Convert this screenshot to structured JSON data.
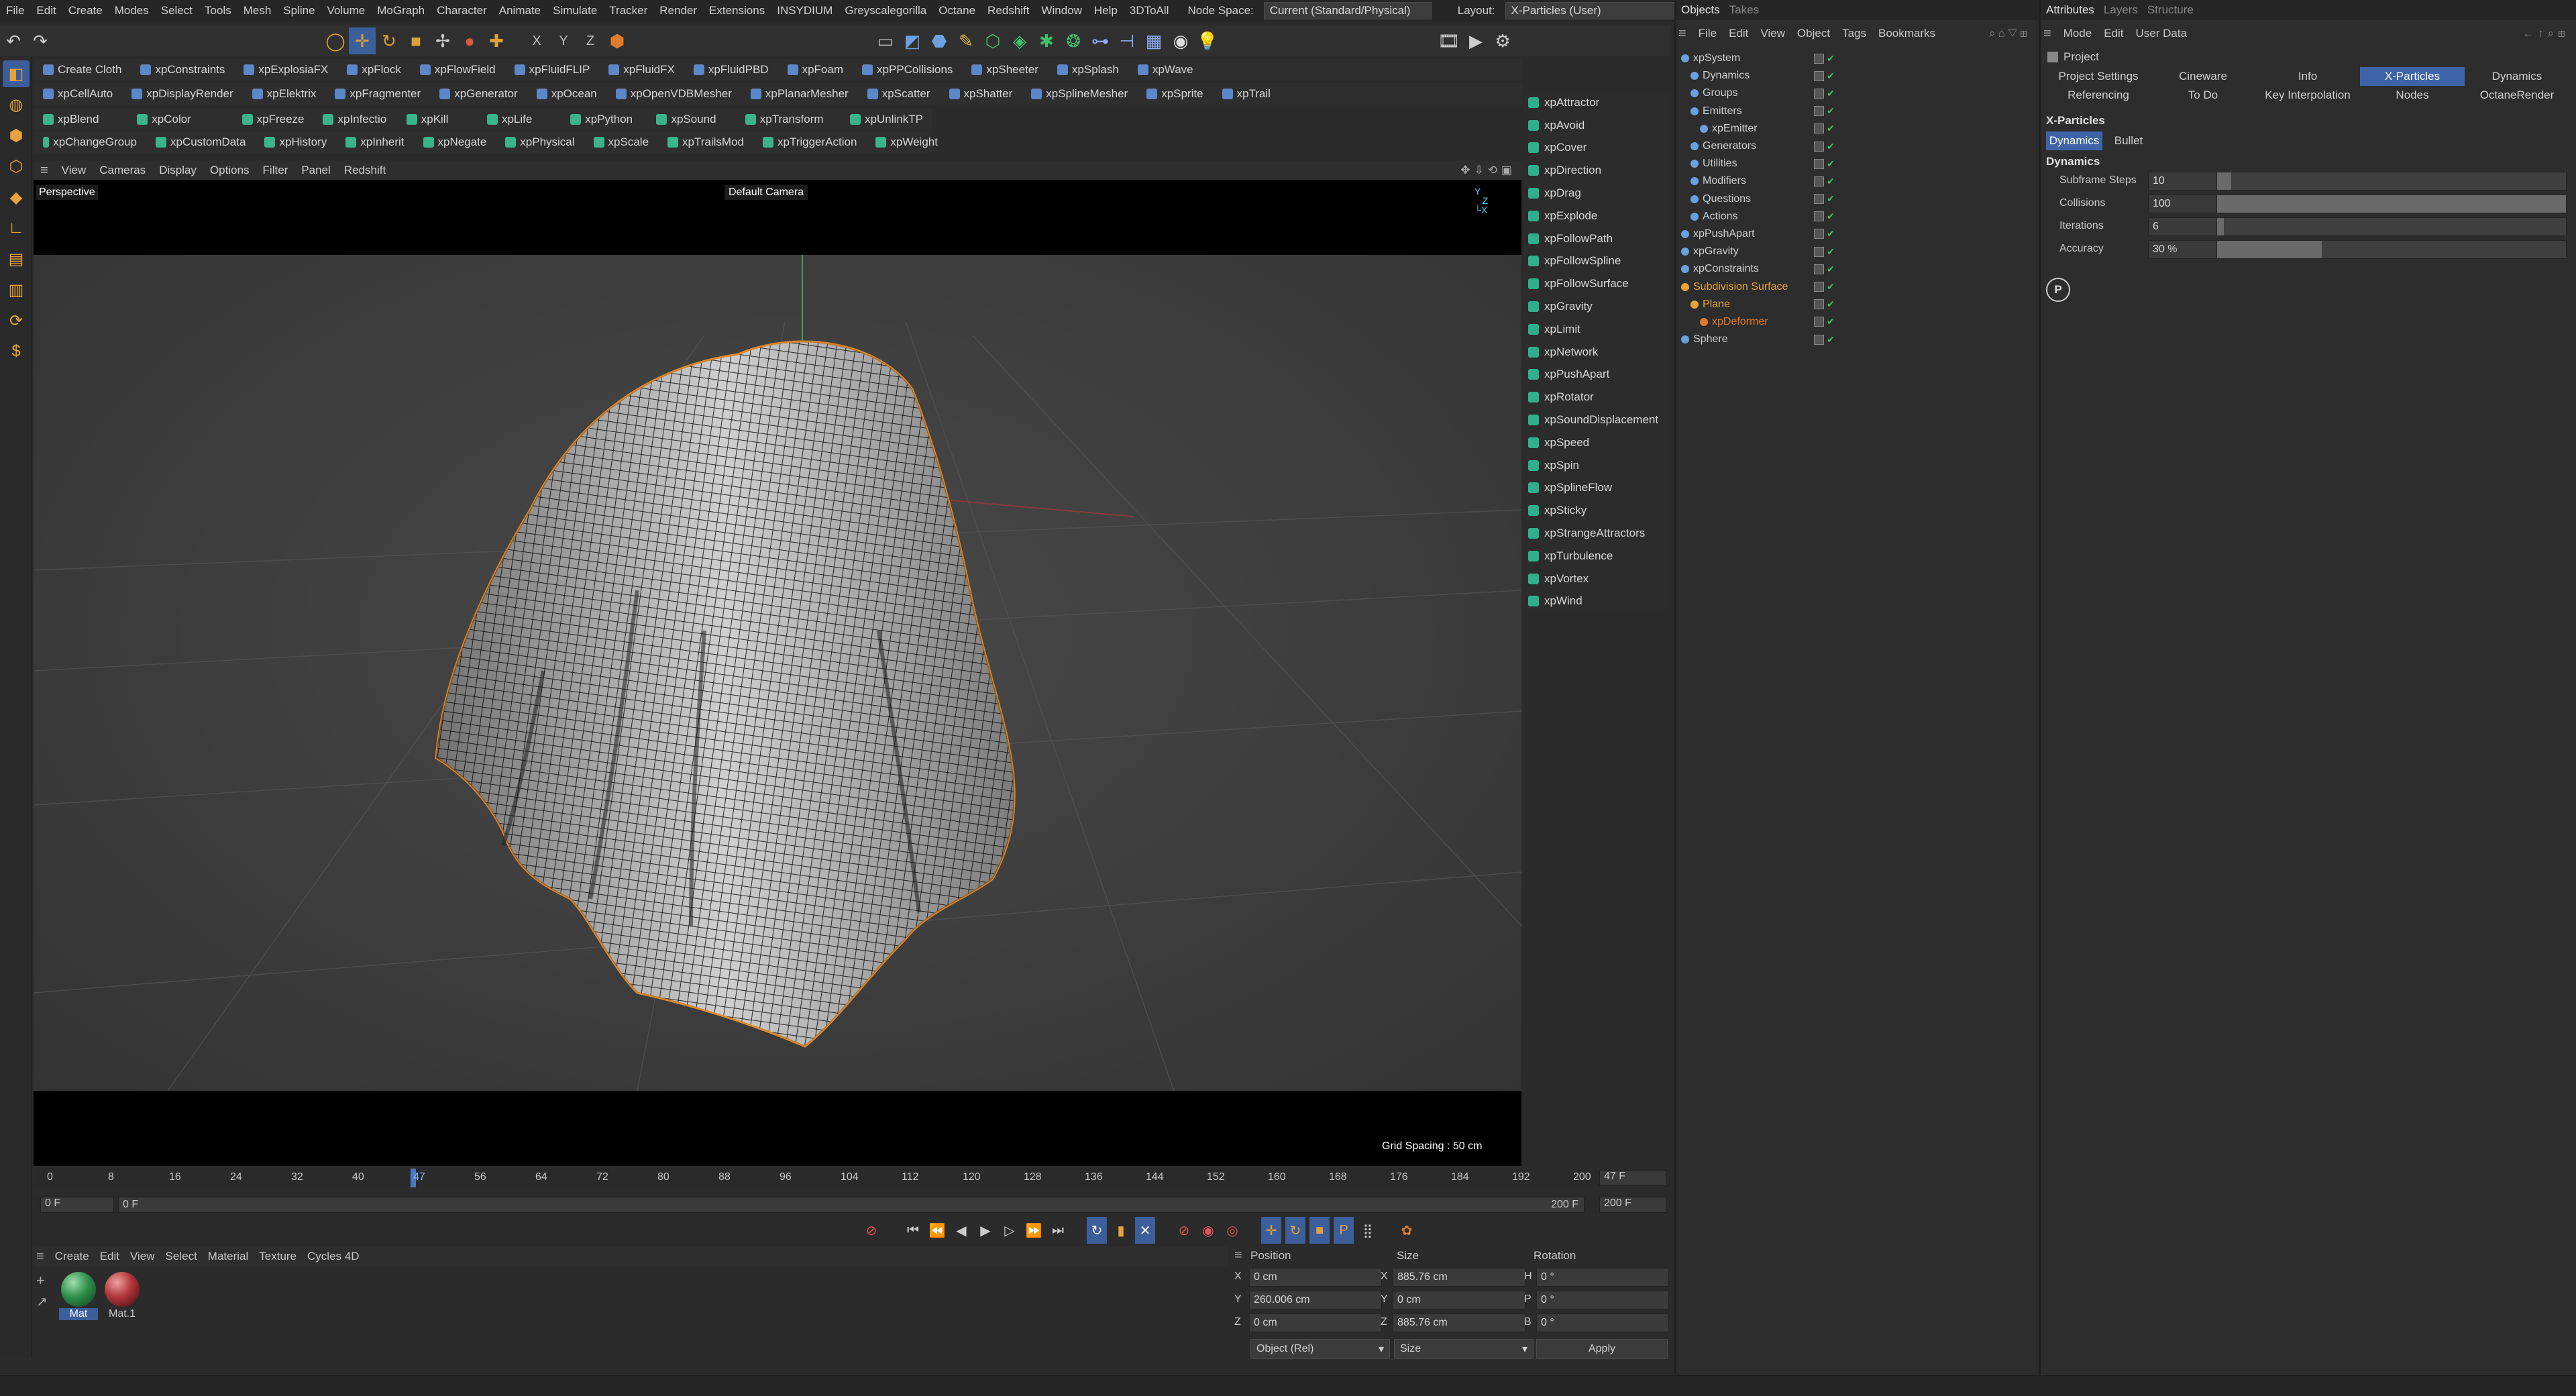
{
  "menubar": {
    "items": [
      "File",
      "Edit",
      "Create",
      "Modes",
      "Select",
      "Tools",
      "Mesh",
      "Spline",
      "Volume",
      "MoGraph",
      "Character",
      "Animate",
      "Simulate",
      "Tracker",
      "Render",
      "Extensions",
      "INSYDIUM",
      "Greyscalegorilla",
      "Octane",
      "Redshift",
      "Window",
      "Help",
      "3DToAll"
    ],
    "node_space_label": "Node Space:",
    "node_space_value": "Current (Standard/Physical)",
    "layout_label": "Layout:",
    "layout_value": "X-Particles (User)"
  },
  "toolbar": {
    "axis_labels": [
      "X",
      "Y",
      "Z"
    ]
  },
  "plugin_rows": {
    "row1": [
      "Create Cloth",
      "xpConstraints",
      "xpExplosiaFX",
      "xpFlock",
      "xpFlowField",
      "xpFluidFLIP",
      "xpFluidFX",
      "xpFluidPBD",
      "xpFoam",
      "xpPPCollisions",
      "xpSheeter",
      "xpSplash",
      "xpWave"
    ],
    "row2": [
      "xpCellAuto",
      "xpDisplayRender",
      "xpElektrix",
      "xpFragmenter",
      "xpGenerator",
      "xpOcean",
      "xpOpenVDBMesher",
      "xpPlanarMesher",
      "xpScatter",
      "xpShatter",
      "xpSplineMesher",
      "xpSprite",
      "xpTrail"
    ],
    "row3": [
      "xpBlend",
      "xpColor",
      "xpFreeze",
      "xpInfectio",
      "xpKill",
      "xpLife",
      "xpPython",
      "xpSound",
      "xpTransform",
      "xpUnlinkTP"
    ],
    "row4": [
      "xpChangeGroup",
      "xpCustomData",
      "xpHistory",
      "xpInherit",
      "xpNegate",
      "xpPhysical",
      "xpScale",
      "xpTrailsMod",
      "xpTriggerAction",
      "xpWeight"
    ]
  },
  "viewport": {
    "menu": [
      "View",
      "Cameras",
      "Display",
      "Options",
      "Filter",
      "Panel",
      "Redshift"
    ],
    "label": "Perspective",
    "camera": "Default Camera",
    "grid_spacing": "Grid Spacing : 50 cm"
  },
  "generators": [
    "xpAttractor",
    "xpAvoid",
    "xpCover",
    "xpDirection",
    "xpDrag",
    "xpExplode",
    "xpFollowPath",
    "xpFollowSpline",
    "xpFollowSurface",
    "xpGravity",
    "xpLimit",
    "xpNetwork",
    "xpPushApart",
    "xpRotator",
    "xpSoundDisplacement",
    "xpSpeed",
    "xpSpin",
    "xpSplineFlow",
    "xpSticky",
    "xpStrangeAttractors",
    "xpTurbulence",
    "xpVortex",
    "xpWind"
  ],
  "objects": {
    "tabs": [
      "Objects",
      "Takes"
    ],
    "menu": [
      "File",
      "Edit",
      "View",
      "Object",
      "Tags",
      "Bookmarks"
    ],
    "tree": [
      {
        "name": "xpSystem",
        "level": 0,
        "color": "#cfcfcf"
      },
      {
        "name": "Dynamics",
        "level": 1,
        "color": "#cfcfcf"
      },
      {
        "name": "Groups",
        "level": 1,
        "color": "#cfcfcf"
      },
      {
        "name": "Emitters",
        "level": 1,
        "color": "#cfcfcf"
      },
      {
        "name": "xpEmitter",
        "level": 2,
        "color": "#cfcfcf"
      },
      {
        "name": "Generators",
        "level": 1,
        "color": "#cfcfcf"
      },
      {
        "name": "Utilities",
        "level": 1,
        "color": "#cfcfcf"
      },
      {
        "name": "Modifiers",
        "level": 1,
        "color": "#cfcfcf"
      },
      {
        "name": "Questions",
        "level": 1,
        "color": "#cfcfcf"
      },
      {
        "name": "Actions",
        "level": 1,
        "color": "#cfcfcf"
      },
      {
        "name": "xpPushApart",
        "level": 0,
        "color": "#cfcfcf"
      },
      {
        "name": "xpGravity",
        "level": 0,
        "color": "#cfcfcf"
      },
      {
        "name": "xpConstraints",
        "level": 0,
        "color": "#cfcfcf"
      },
      {
        "name": "Subdivision Surface",
        "level": 0,
        "color": "#e8a23a"
      },
      {
        "name": "Plane",
        "level": 1,
        "color": "#e8a23a"
      },
      {
        "name": "xpDeformer",
        "level": 2,
        "color": "#e07b2a"
      },
      {
        "name": "Sphere",
        "level": 0,
        "color": "#cfcfcf"
      }
    ]
  },
  "attributes": {
    "tabs": [
      "Attributes",
      "Layers",
      "Structure"
    ],
    "menu": [
      "Mode",
      "Edit",
      "User Data"
    ],
    "object_title": "Project",
    "tab_row1": [
      "Project Settings",
      "Cineware",
      "Info",
      "X-Particles",
      "Dynamics"
    ],
    "tab_row2": [
      "Referencing",
      "To Do",
      "Key Interpolation",
      "Nodes",
      "OctaneRender"
    ],
    "active_tab": "X-Particles",
    "section_title": "X-Particles",
    "subtabs": [
      "Dynamics",
      "Bullet"
    ],
    "group_title": "Dynamics",
    "params": [
      {
        "label": "Subframe Steps",
        "value": "10",
        "fill": 0.04
      },
      {
        "label": "Collisions",
        "value": "100",
        "fill": 1.0
      },
      {
        "label": "Iterations",
        "value": "6",
        "fill": 0.02
      },
      {
        "label": "Accuracy",
        "value": "30 %",
        "fill": 0.3
      }
    ]
  },
  "timeline": {
    "ticks": [
      "0",
      "8",
      "16",
      "24",
      "32",
      "40",
      "47",
      "56",
      "64",
      "72",
      "80",
      "88",
      "96",
      "104",
      "112",
      "120",
      "128",
      "136",
      "144",
      "152",
      "160",
      "168",
      "176",
      "184",
      "192",
      "200"
    ],
    "current_frame": "47 F",
    "start_frame": "0 F",
    "range_start": "0 F",
    "range_end": "200 F",
    "end_frame": "200 F"
  },
  "materials": {
    "menu": [
      "Create",
      "Edit",
      "View",
      "Select",
      "Material",
      "Texture",
      "Cycles 4D"
    ],
    "items": [
      {
        "name": "Mat",
        "color": "#2f8f4a"
      },
      {
        "name": "Mat.1",
        "color": "#b0353a"
      }
    ]
  },
  "coordinates": {
    "headers": [
      "Position",
      "Size",
      "Rotation"
    ],
    "rows": [
      {
        "axis": "X",
        "pos": "0 cm",
        "size_axis": "X",
        "size": "885.76 cm",
        "rot_axis": "H",
        "rot": "0 °"
      },
      {
        "axis": "Y",
        "pos": "260.006 cm",
        "size_axis": "Y",
        "size": "0 cm",
        "rot_axis": "P",
        "rot": "0 °"
      },
      {
        "axis": "Z",
        "pos": "0 cm",
        "size_axis": "Z",
        "size": "885.76 cm",
        "rot_axis": "B",
        "rot": "0 °"
      }
    ],
    "mode": "Object (Rel)",
    "size_mode": "Size",
    "apply": "Apply"
  }
}
